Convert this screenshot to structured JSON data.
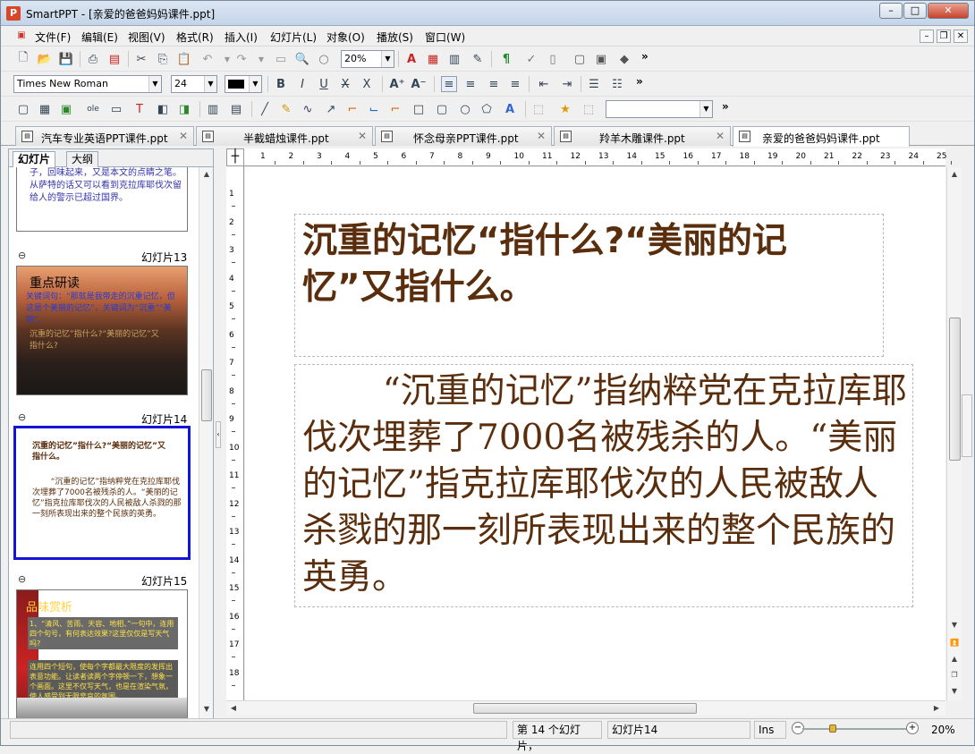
{
  "window": {
    "title": "SmartPPT - [亲爱的爸爸妈妈课件.ppt]",
    "app_icon": "P"
  },
  "menubar": {
    "items": [
      "文件(F)",
      "编辑(E)",
      "视图(V)",
      "格式(R)",
      "插入(I)",
      "幻灯片(L)",
      "对象(O)",
      "播放(S)",
      "窗口(W)"
    ]
  },
  "toolbar1": {
    "zoom": "20%"
  },
  "toolbar2": {
    "font": "Times New Roman",
    "size": "24"
  },
  "toolbar3": {
    "combo_value": ""
  },
  "doc_tabs": [
    {
      "label": "汽车专业英语PPT课件.ppt"
    },
    {
      "label": "半截蜡烛课件.ppt"
    },
    {
      "label": "怀念母亲PPT课件.ppt"
    },
    {
      "label": "羚羊木雕课件.ppt"
    },
    {
      "label": "亲爱的爸爸妈妈课件.ppt"
    }
  ],
  "left_pane": {
    "tabs": [
      "幻灯片",
      "大纲"
    ],
    "prev_slide_text": "子，回味起来，又是本文的点睛之笔。从萨特的话又可以看到克拉库耶伐次留给人的警示已超过国界。",
    "slides": [
      {
        "label": "幻灯片13",
        "title": "重点研读",
        "lines": [
          "关键词句：“那就是我带走的沉重记忆，但这是个美丽的记忆”，关键词为“沉重”“美丽”。",
          "沉重的记忆”指什么?“美丽的记忆”又指什么?"
        ]
      },
      {
        "label": "幻灯片14",
        "title": "沉重的记忆”指什么?“美丽的记忆”又指什么。",
        "body": "“沉重的记忆”指纳粹党在克拉库耶伐次埋葬了7000名被残杀的人。“美丽的记忆”指克拉库耶伐次的人民被敌人杀戮的那一刻所表现出来的整个民族的英勇。"
      },
      {
        "label": "幻灯片15",
        "title": "品味赏析",
        "box1": "1、“清风、苦雨、天容、地相、”一句中，连用四个句号，有何表达效果?这里仅仅是写天气吗?",
        "box2": "连用四个短句，使每个字都最大限度的发挥出表意功能。让读者读两个字停顿一下，想象一个画面。这里不仅写天气，也是在渲染气氛，使人感受到无限悲哀的氛围。"
      }
    ]
  },
  "slide": {
    "title": "沉重的记忆“指什么?“美丽的记忆”又指什么。",
    "body": "“沉重的记忆”指纳粹党在克拉库耶伐次埋葬了7000名被残杀的人。“美丽的记忆”指克拉库耶伐次的人民被敌人杀戮的那一刻所表现出来的整个民族的英勇。"
  },
  "ruler": {
    "h": [
      "1",
      "2",
      "3",
      "4",
      "5",
      "6",
      "7",
      "8",
      "9",
      "10",
      "11",
      "12",
      "13",
      "14",
      "15",
      "16",
      "17",
      "18",
      "19",
      "20",
      "21",
      "22",
      "23",
      "24",
      "25"
    ],
    "v": [
      "1",
      "2",
      "3",
      "4",
      "5",
      "6",
      "7",
      "8",
      "9",
      "10",
      "11",
      "12",
      "13",
      "14",
      "15",
      "16",
      "17",
      "18"
    ]
  },
  "status": {
    "count": "第 14 个幻灯片，",
    "current": "幻灯片14",
    "mode": "Ins",
    "zoom": "20%"
  }
}
